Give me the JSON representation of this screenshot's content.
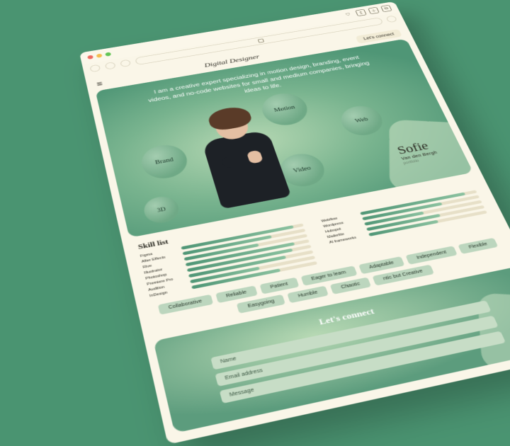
{
  "browser": {
    "toolbar_icons": [
      "shield-icon",
      "share-icon",
      "plus-icon",
      "tabs-icon"
    ]
  },
  "header": {
    "site_title": "Digital Designer",
    "cta": "Let's connect"
  },
  "hero": {
    "intro": "I am a creative expert specializing in motion design, branding, event videos, and no-code websites for small and medium companies, bringing ideas to life.",
    "bubbles": {
      "brand": "Brand",
      "motion": "Motion",
      "web": "Web",
      "video": "Video",
      "threeD": "3D"
    },
    "name": {
      "first": "Sofie",
      "last": "Van den Bergh",
      "subtitle": "portfolio"
    }
  },
  "skills": {
    "title": "Skill list",
    "left": [
      {
        "label": "Figma",
        "value": 92
      },
      {
        "label": "After Effects",
        "value": 72
      },
      {
        "label": "Rive",
        "value": 60
      },
      {
        "label": "Illustrator",
        "value": 88
      },
      {
        "label": "Photoshop",
        "value": 85
      },
      {
        "label": "Premiere Pro",
        "value": 78
      },
      {
        "label": "Audition",
        "value": 55
      },
      {
        "label": "InDesign",
        "value": 70
      }
    ],
    "right": [
      {
        "label": "Webflow",
        "value": 90
      },
      {
        "label": "Wordpress",
        "value": 68
      },
      {
        "label": "Hubspot",
        "value": 50
      },
      {
        "label": "Mailerlite",
        "value": 62
      },
      {
        "label": "AI frameworks",
        "value": 58
      }
    ]
  },
  "tags": [
    "Collaborative",
    "Reliable",
    "Patient",
    "Eager to learn",
    "Adaptable",
    "Independent",
    "Flexible",
    "Easygoing",
    "Humble",
    "Chaotic",
    "ntic but Creative"
  ],
  "contact": {
    "title": "Let's connect",
    "fields": {
      "name": "Name",
      "email": "Email address",
      "message": "Message"
    }
  }
}
